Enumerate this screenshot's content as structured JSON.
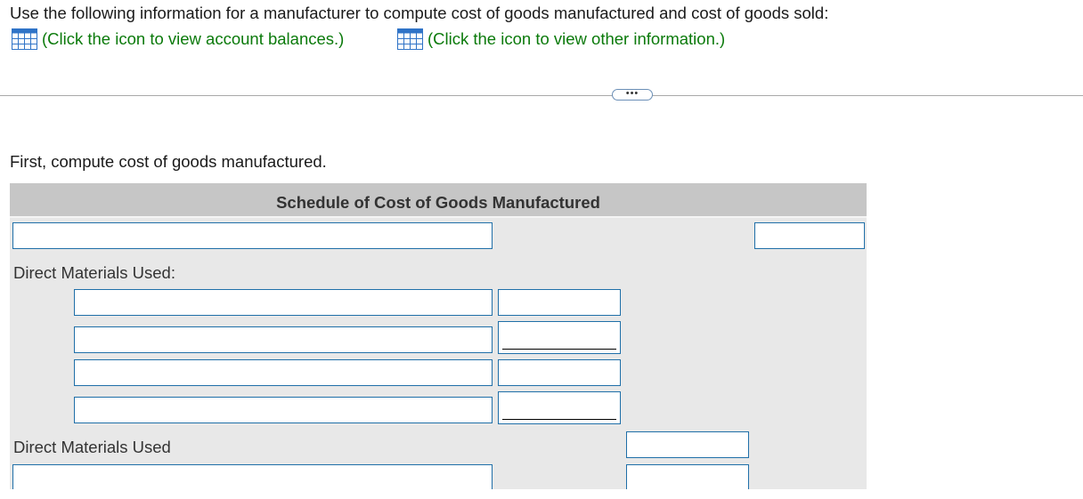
{
  "intro_text": "Use the following information for a manufacturer to compute cost of goods manufactured and cost of goods sold:",
  "links": {
    "account_balances": "(Click the icon to view account balances.)",
    "other_information": "(Click the icon to view other information.)"
  },
  "divider": {
    "expand_label": "•••"
  },
  "instruction_text": "First, compute cost of goods manufactured.",
  "schedule": {
    "title": "Schedule of Cost of Goods Manufactured",
    "direct_materials_heading": "Direct Materials Used:",
    "direct_materials_total_label": "Direct Materials Used"
  },
  "colors": {
    "link_green": "#0b7a0b",
    "input_border": "#1f6fa8",
    "header_gray": "#c6c6c6",
    "panel_gray": "#e8e8e8",
    "grid_icon_blue": "#2f73c7"
  },
  "icons": {
    "account_balances_icon": "table-grid-icon",
    "other_information_icon": "table-grid-icon"
  }
}
